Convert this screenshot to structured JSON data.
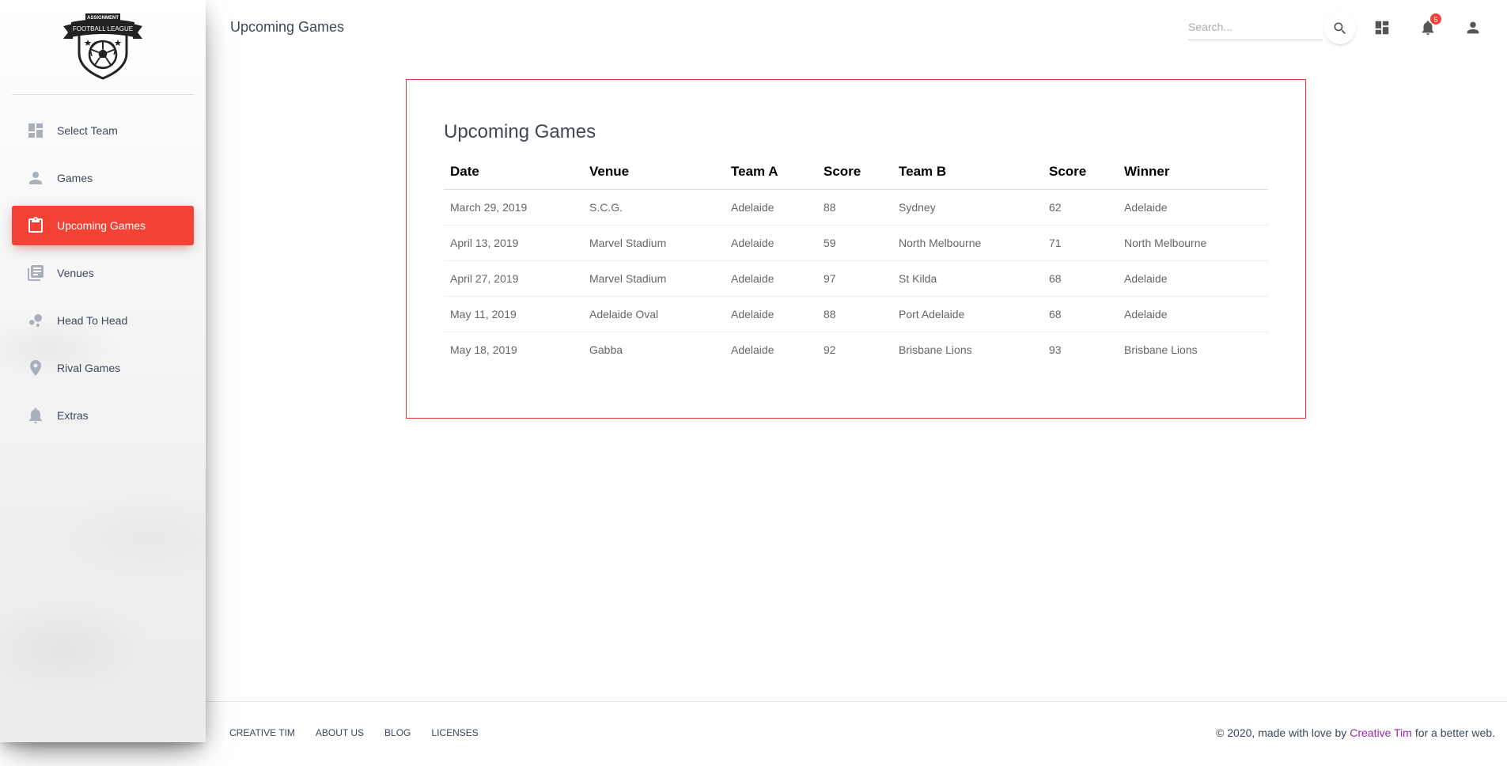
{
  "colors": {
    "accent": "#f44336",
    "card_border": "#e53935",
    "link": "#9c27b0",
    "text": "#3c4858"
  },
  "sidebar": {
    "logo": {
      "top_text": "ASSIGNMENT",
      "banner_text": "FOOTBALL LEAGUE"
    },
    "items": [
      {
        "label": "Select Team",
        "icon": "dashboard-icon",
        "active": false
      },
      {
        "label": "Games",
        "icon": "person-icon",
        "active": false
      },
      {
        "label": "Upcoming Games",
        "icon": "clipboard-icon",
        "active": true
      },
      {
        "label": "Venues",
        "icon": "library-books-icon",
        "active": false
      },
      {
        "label": "Head To Head",
        "icon": "bubble-chart-icon",
        "active": false
      },
      {
        "label": "Rival Games",
        "icon": "location-pin-icon",
        "active": false
      },
      {
        "label": "Extras",
        "icon": "bell-icon",
        "active": false
      }
    ]
  },
  "header": {
    "title": "Upcoming Games",
    "search_placeholder": "Search...",
    "notification_count": "5",
    "icons": [
      "search-icon",
      "dashboard-icon",
      "notifications-icon",
      "person-icon"
    ]
  },
  "main": {
    "card_title": "Upcoming Games",
    "table": {
      "columns": [
        "Date",
        "Venue",
        "Team A",
        "Score",
        "Team B",
        "Score",
        "Winner"
      ],
      "rows": [
        [
          "March 29, 2019",
          "S.C.G.",
          "Adelaide",
          "88",
          "Sydney",
          "62",
          "Adelaide"
        ],
        [
          "April 13, 2019",
          "Marvel Stadium",
          "Adelaide",
          "59",
          "North Melbourne",
          "71",
          "North Melbourne"
        ],
        [
          "April 27, 2019",
          "Marvel Stadium",
          "Adelaide",
          "97",
          "St Kilda",
          "68",
          "Adelaide"
        ],
        [
          "May 11, 2019",
          "Adelaide Oval",
          "Adelaide",
          "88",
          "Port Adelaide",
          "68",
          "Adelaide"
        ],
        [
          "May 18, 2019",
          "Gabba",
          "Adelaide",
          "92",
          "Brisbane Lions",
          "93",
          "Brisbane Lions"
        ]
      ]
    }
  },
  "footer": {
    "links": [
      "Creative Tim",
      "About Us",
      "Blog",
      "Licenses"
    ],
    "copyright_prefix": "© 2020, made with love by",
    "copyright_brand": "Creative Tim",
    "copyright_suffix": "for a better web."
  }
}
